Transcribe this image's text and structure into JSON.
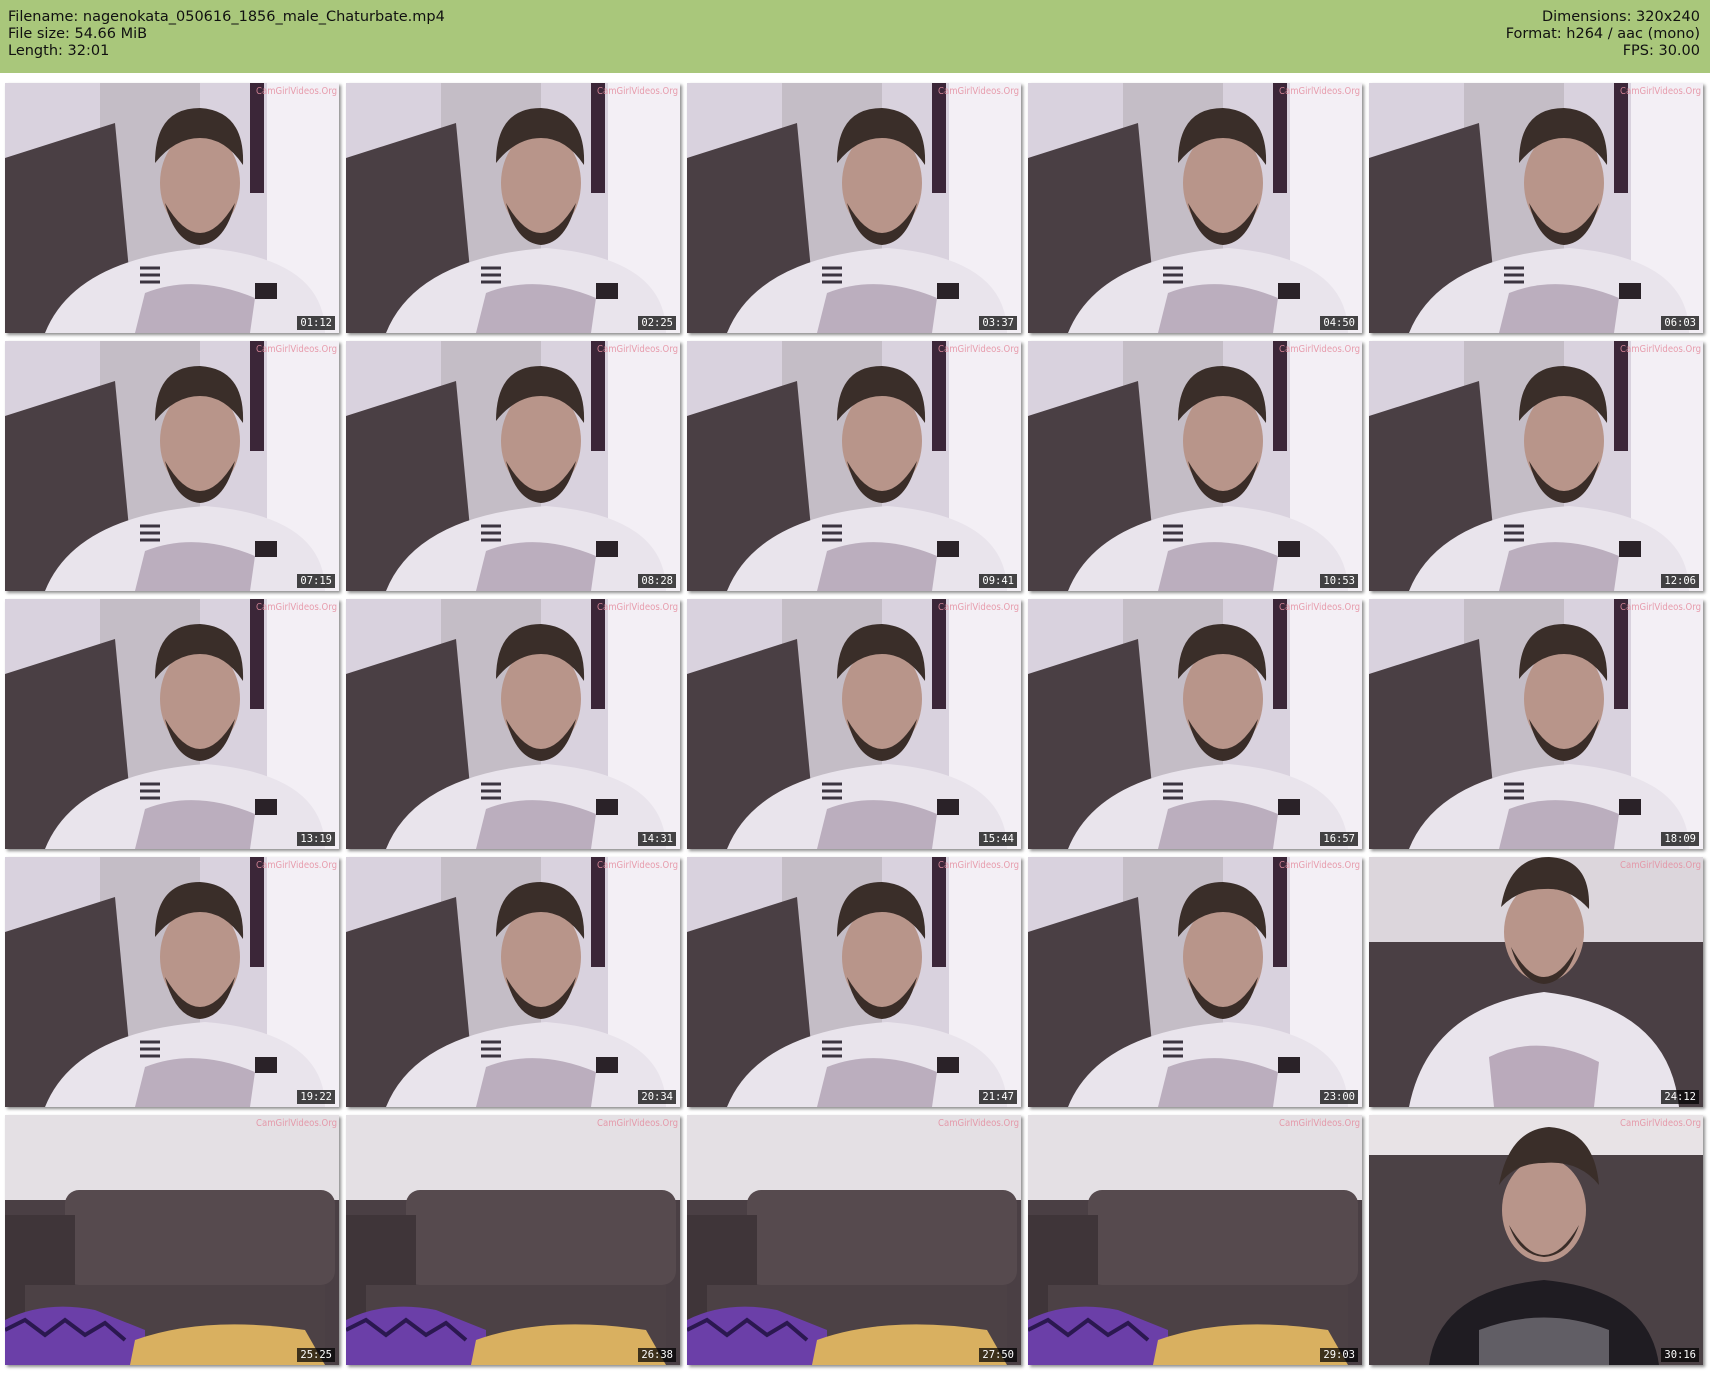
{
  "header": {
    "filename_label": "Filename: nagenokata_050616_1856_male_Chaturbate.mp4",
    "filesize_label": "File size: 54.66 MiB",
    "length_label": "Length: 32:01",
    "dimensions_label": "Dimensions: 320x240",
    "format_label": "Format: h264 / aac (mono)",
    "fps_label": "FPS: 30.00"
  },
  "watermark": "CamGirlVideos.Org",
  "colors": {
    "header_bg": "#a9c77b",
    "wall": "#d9d2de",
    "sofa": "#4a3f44",
    "shirt": "#e9e4ec",
    "hair": "#3a2e29",
    "skin": "#b8958a",
    "blanket": "#6b3fa8",
    "pillow": "#d9b060"
  },
  "thumbnails": [
    {
      "time": "01:12",
      "scene": "closeup"
    },
    {
      "time": "02:25",
      "scene": "closeup"
    },
    {
      "time": "03:37",
      "scene": "closeup"
    },
    {
      "time": "04:50",
      "scene": "closeup"
    },
    {
      "time": "06:03",
      "scene": "closeup"
    },
    {
      "time": "07:15",
      "scene": "closeup"
    },
    {
      "time": "08:28",
      "scene": "closeup"
    },
    {
      "time": "09:41",
      "scene": "closeup"
    },
    {
      "time": "10:53",
      "scene": "closeup"
    },
    {
      "time": "12:06",
      "scene": "closeup"
    },
    {
      "time": "13:19",
      "scene": "closeup"
    },
    {
      "time": "14:31",
      "scene": "closeup"
    },
    {
      "time": "15:44",
      "scene": "closeup"
    },
    {
      "time": "16:57",
      "scene": "closeup"
    },
    {
      "time": "18:09",
      "scene": "closeup"
    },
    {
      "time": "19:22",
      "scene": "closeup"
    },
    {
      "time": "20:34",
      "scene": "closeup"
    },
    {
      "time": "21:47",
      "scene": "closeup"
    },
    {
      "time": "23:00",
      "scene": "closeup"
    },
    {
      "time": "24:12",
      "scene": "couch-seated"
    },
    {
      "time": "25:25",
      "scene": "empty-couch"
    },
    {
      "time": "26:38",
      "scene": "empty-couch"
    },
    {
      "time": "27:50",
      "scene": "empty-couch"
    },
    {
      "time": "29:03",
      "scene": "empty-couch"
    },
    {
      "time": "30:16",
      "scene": "dark-shirt"
    }
  ]
}
